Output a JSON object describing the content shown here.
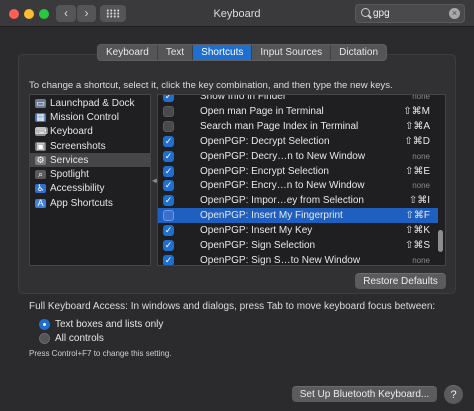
{
  "window": {
    "title": "Keyboard"
  },
  "toolbar": {
    "back_icon": "chevron-left-icon",
    "forward_icon": "chevron-right-icon",
    "grid_icon": "grid-icon"
  },
  "search": {
    "value": "gpg",
    "clear_glyph": "×"
  },
  "tabs": [
    {
      "label": "Keyboard",
      "active": false
    },
    {
      "label": "Text",
      "active": false
    },
    {
      "label": "Shortcuts",
      "active": true
    },
    {
      "label": "Input Sources",
      "active": false
    },
    {
      "label": "Dictation",
      "active": false
    }
  ],
  "instruction": "To change a shortcut, select it, click the key combination, and then type the new keys.",
  "categories": [
    {
      "label": "Launchpad & Dock",
      "icon": "launchpad-icon",
      "glyph": "▭",
      "color": "#6b7d92",
      "selected": false
    },
    {
      "label": "Mission Control",
      "icon": "mission-control-icon",
      "glyph": "▦",
      "color": "#4a79b8",
      "selected": false
    },
    {
      "label": "Keyboard",
      "icon": "keyboard-icon",
      "glyph": "⌨",
      "color": "#8a8a8a",
      "selected": false
    },
    {
      "label": "Screenshots",
      "icon": "screenshots-icon",
      "glyph": "▣",
      "color": "#7d7d7d",
      "selected": false
    },
    {
      "label": "Services",
      "icon": "gear-icon",
      "glyph": "⚙",
      "color": "#7b7b7b",
      "selected": true
    },
    {
      "label": "Spotlight",
      "icon": "spotlight-icon",
      "glyph": "⌕",
      "color": "#5a5a5a",
      "selected": false
    },
    {
      "label": "Accessibility",
      "icon": "accessibility-icon",
      "glyph": "♿",
      "color": "#2f6fd4",
      "selected": false
    },
    {
      "label": "App Shortcuts",
      "icon": "app-shortcuts-icon",
      "glyph": "A",
      "color": "#3b7fe0",
      "selected": false
    }
  ],
  "shortcuts": [
    {
      "name": "Show Info in Finder",
      "key": "none",
      "checked": true,
      "selected": false
    },
    {
      "name": "Open man Page in Terminal",
      "key": "⇧⌘M",
      "checked": false,
      "selected": false
    },
    {
      "name": "Search man Page Index in Terminal",
      "key": "⇧⌘A",
      "checked": false,
      "selected": false
    },
    {
      "name": "OpenPGP: Decrypt Selection",
      "key": "⇧⌘D",
      "checked": true,
      "selected": false
    },
    {
      "name": "OpenPGP: Decry…n to New Window",
      "key": "none",
      "checked": true,
      "selected": false
    },
    {
      "name": "OpenPGP: Encrypt Selection",
      "key": "⇧⌘E",
      "checked": true,
      "selected": false
    },
    {
      "name": "OpenPGP: Encry…n to New Window",
      "key": "none",
      "checked": true,
      "selected": false
    },
    {
      "name": "OpenPGP: Impor…ey from Selection",
      "key": "⇧⌘I",
      "checked": true,
      "selected": false
    },
    {
      "name": "OpenPGP: Insert My Fingerprint",
      "key": "⇧⌘F",
      "checked": false,
      "selected": true
    },
    {
      "name": "OpenPGP: Insert My Key",
      "key": "⇧⌘K",
      "checked": true,
      "selected": false
    },
    {
      "name": "OpenPGP: Sign Selection",
      "key": "⇧⌘S",
      "checked": true,
      "selected": false
    },
    {
      "name": "OpenPGP: Sign S…to New Window",
      "key": "none",
      "checked": true,
      "selected": false
    }
  ],
  "buttons": {
    "restore_defaults": "Restore Defaults",
    "bluetooth": "Set Up Bluetooth Keyboard...",
    "help": "?"
  },
  "full_keyboard_access": {
    "label": "Full Keyboard Access: In windows and dialogs, press Tab to move keyboard focus between:",
    "options": [
      {
        "label": "Text boxes and lists only",
        "selected": true
      },
      {
        "label": "All controls",
        "selected": false
      }
    ],
    "hint": "Press Control+F7 to change this setting."
  },
  "colors": {
    "accent": "#1f6fd0",
    "background": "#2b2a2c"
  }
}
